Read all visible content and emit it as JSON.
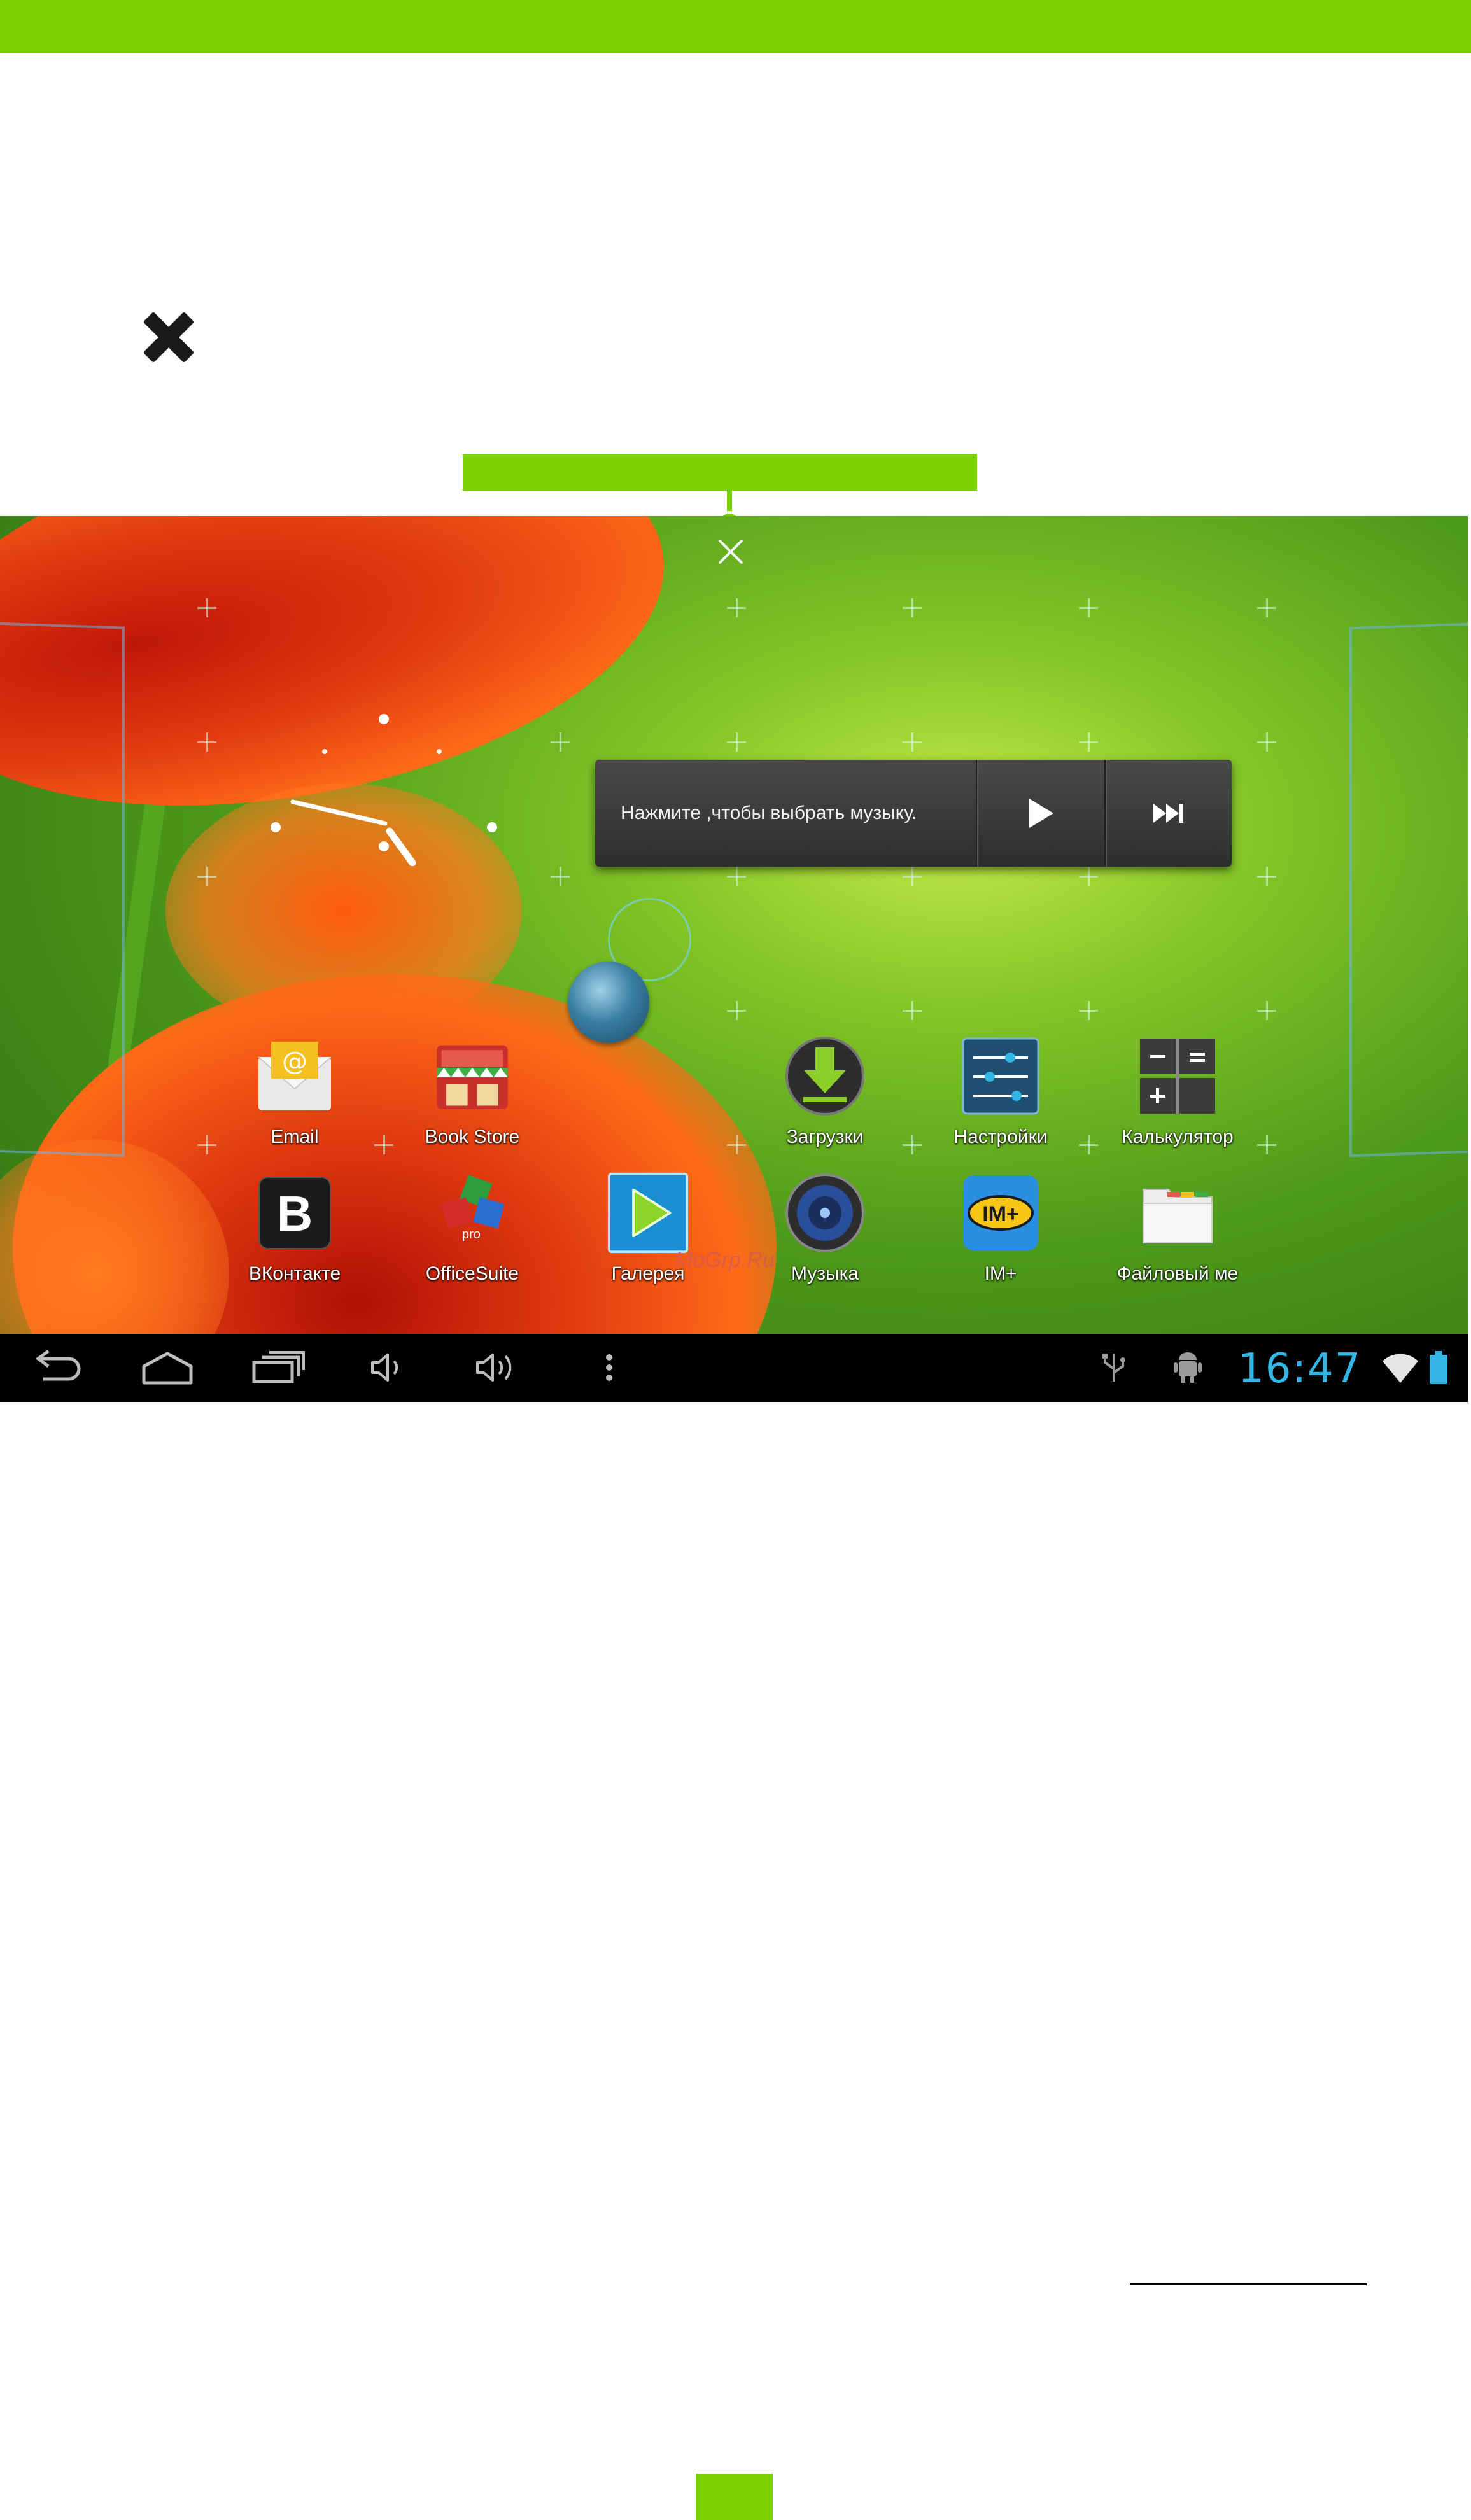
{
  "colors": {
    "accent_green": "#79d000",
    "system_clock_blue": "#33b5e5",
    "widget_grey": "#3a3a3a"
  },
  "close_icon": "close-x-icon",
  "music_widget": {
    "prompt": "Нажмите ,чтобы выбрать музыку.",
    "play_icon": "play-icon",
    "next_icon": "skip-next-icon"
  },
  "apps": [
    {
      "label": "Email",
      "icon": "email-icon"
    },
    {
      "label": "Book Store",
      "icon": "book-store-icon"
    },
    {
      "label": "Загрузки",
      "icon": "download-icon"
    },
    {
      "label": "Настройки",
      "icon": "settings-icon"
    },
    {
      "label": "Калькулятор",
      "icon": "calculator-icon"
    },
    {
      "label": "ВКонтакте",
      "icon": "vkontakte-icon"
    },
    {
      "label": "OfficeSuite",
      "icon": "officesuite-icon"
    },
    {
      "label": "Галерея",
      "icon": "gallery-icon"
    },
    {
      "label": "Музыка",
      "icon": "music-icon"
    },
    {
      "label": "IM+",
      "icon": "im-plus-icon"
    },
    {
      "label": "Файловый ме",
      "icon": "file-manager-icon"
    }
  ],
  "officesuite_badge": "pro",
  "im_badge": "IM+",
  "vk_letter": "B",
  "watermark": "MoGrp.Ru",
  "navigation": {
    "buttons": [
      "back-icon",
      "home-icon",
      "recent-apps-icon",
      "volume-down-icon",
      "volume-up-icon",
      "menu-icon"
    ]
  },
  "status_bar": {
    "time": "16:47",
    "icons": [
      "usb-icon",
      "android-debug-icon",
      "wifi-icon",
      "battery-icon"
    ]
  }
}
